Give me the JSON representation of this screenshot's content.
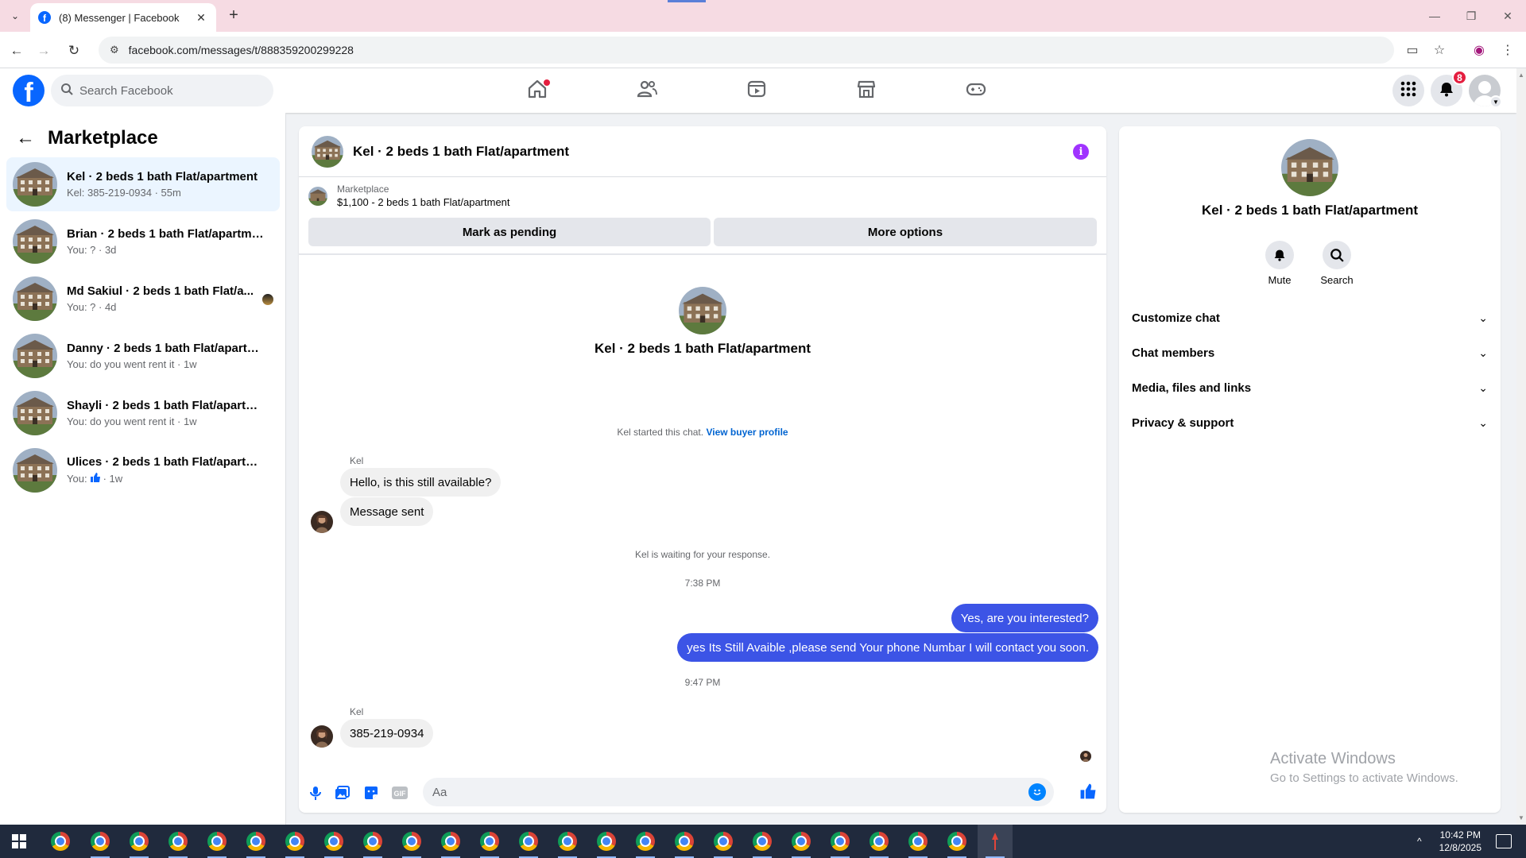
{
  "browser": {
    "tab_title": "(8) Messenger | Facebook",
    "url": "facebook.com/messages/t/888359200299228",
    "window_controls": [
      "—",
      "❐",
      "✕"
    ]
  },
  "header": {
    "search_placeholder": "Search Facebook",
    "nav_items": [
      "home-icon",
      "friends-icon",
      "video-icon",
      "marketplace-icon",
      "gaming-icon"
    ],
    "notification_count": "8",
    "brand_color": "#0866ff"
  },
  "sidebar": {
    "title": "Marketplace",
    "conversations": [
      {
        "name": "Kel · 2 beds 1 bath Flat/apartment",
        "snippet": "Kel: 385-219-0934 · 55m",
        "active": true
      },
      {
        "name": "Brian · 2 beds 1 bath Flat/apartment",
        "snippet": "You: ? · 3d"
      },
      {
        "name": "Md Sakiul · 2 beds 1 bath Flat/a...",
        "snippet": "You: ? · 4d"
      },
      {
        "name": "Danny · 2 beds 1 bath Flat/apartm...",
        "snippet": "You: do you went rent it · 1w"
      },
      {
        "name": "Shayli · 2 beds 1 bath Flat/apartme...",
        "snippet": "You: do you went rent it · 1w"
      },
      {
        "name": "Ulices · 2 beds 1 bath Flat/apartme...",
        "snippet_prefix": "You:",
        "snippet_suffix": "· 1w"
      }
    ]
  },
  "chat": {
    "title": "Kel · 2 beds 1 bath Flat/apartment",
    "listing_source": "Marketplace",
    "listing_desc": "$1,100 - 2 beds 1 bath Flat/apartment",
    "mark_pending_label": "Mark as pending",
    "more_options_label": "More options",
    "intro_name": "Kel · 2 beds 1 bath Flat/apartment",
    "started_text": "Kel started this chat.",
    "view_profile_label": "View buyer profile",
    "sender_1": "Kel",
    "msg_in_1": "Hello, is this still available?",
    "msg_in_2": "Message sent",
    "waiting_text": "Kel is waiting for your response.",
    "time_1": "7:38 PM",
    "msg_out_1": "Yes, are you interested?",
    "msg_out_2": "yes Its Still Avaible ,please send Your phone Numbar I will contact you soon.",
    "time_2": "9:47 PM",
    "sender_2": "Kel",
    "msg_in_3": "385-219-0934",
    "composer_placeholder": "Aa",
    "out_bubble_color": "#3c54e6"
  },
  "info_panel": {
    "name": "Kel · 2 beds 1 bath Flat/apartment",
    "mute_label": "Mute",
    "search_label": "Search",
    "sections": [
      "Customize chat",
      "Chat members",
      "Media, files and links",
      "Privacy & support"
    ]
  },
  "watermark": {
    "title": "Activate Windows",
    "subtitle": "Go to Settings to activate Windows."
  },
  "taskbar": {
    "time": "10:42 PM",
    "date": "12/8/2025"
  }
}
